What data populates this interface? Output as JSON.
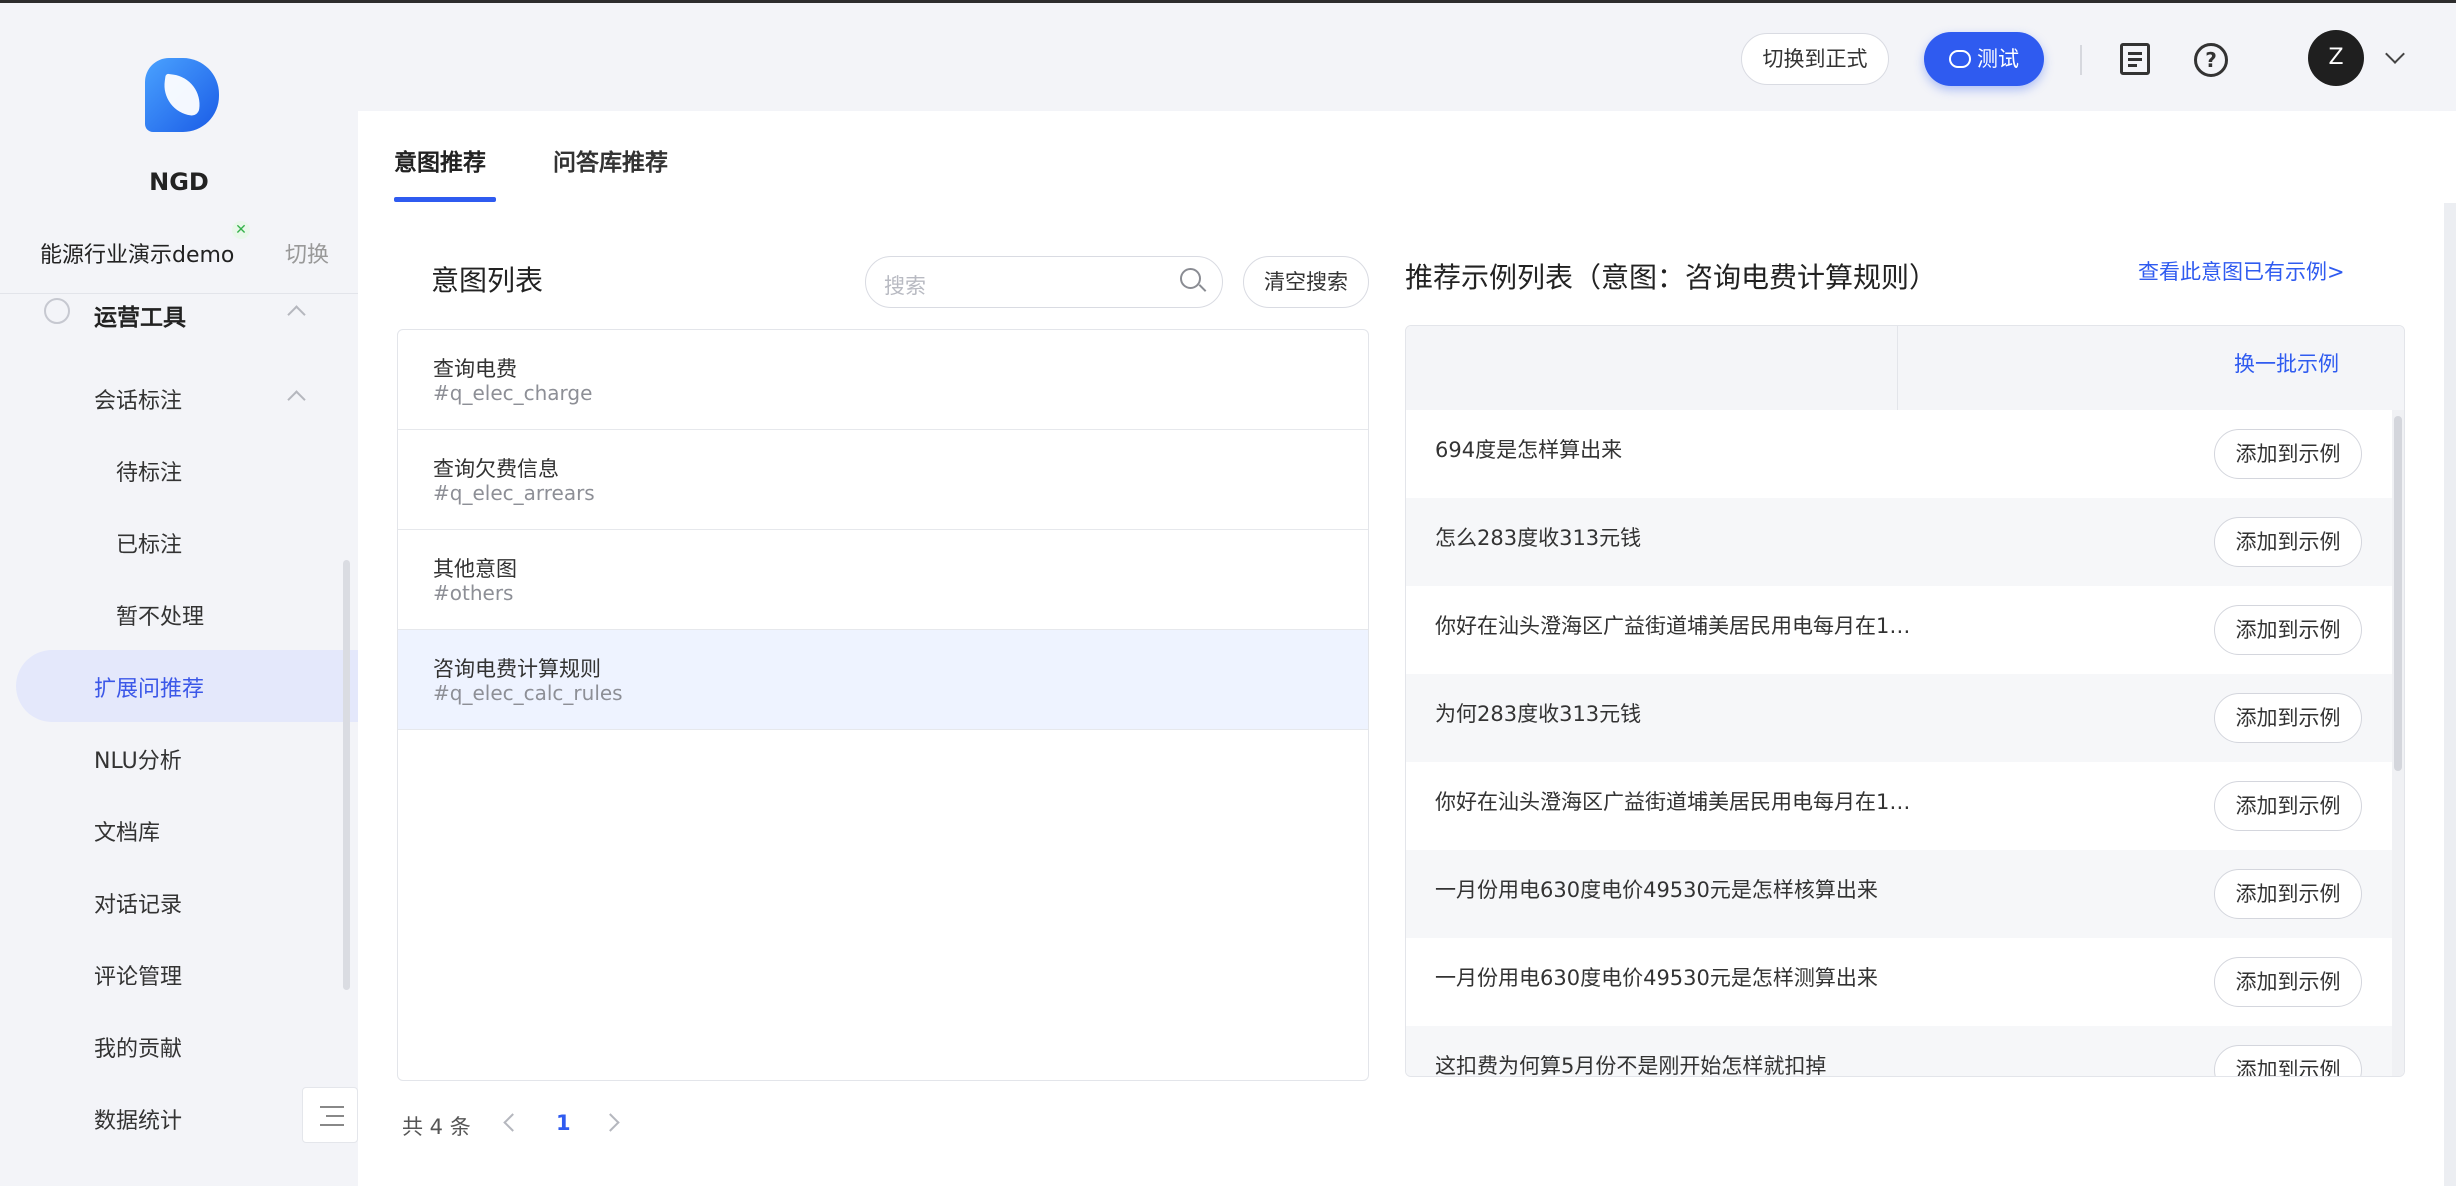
{
  "sidebar": {
    "brand": "NGD",
    "tenant": "能源行业演示demo",
    "tenant_switch": "切换",
    "group": "运营工具",
    "sub_group": "会话标注",
    "sub_items": [
      "待标注",
      "已标注",
      "暂不处理"
    ],
    "items": [
      "扩展问推荐",
      "NLU分析",
      "文档库",
      "对话记录",
      "评论管理",
      "我的贡献",
      "数据统计"
    ],
    "active_item": "扩展问推荐"
  },
  "topbar": {
    "switch_button": "切换到正式",
    "test_button": "测试",
    "avatar_initial": "Z"
  },
  "tabs": [
    "意图推荐",
    "问答库推荐"
  ],
  "intent_panel": {
    "title": "意图列表",
    "search_placeholder": "搜索",
    "clear_button": "清空搜索",
    "intents": [
      {
        "name": "查询电费",
        "id": "#q_elec_charge"
      },
      {
        "name": "查询欠费信息",
        "id": "#q_elec_arrears"
      },
      {
        "name": "其他意图",
        "id": "#others"
      },
      {
        "name": "咨询电费计算规则",
        "id": "#q_elec_calc_rules"
      }
    ],
    "total": "共 4 条",
    "current_page": "1"
  },
  "example_panel": {
    "title": "推荐示例列表（意图：咨询电费计算规则）",
    "view_link": "查看此意图已有示例>",
    "refresh_link": "换一批示例",
    "add_label": "添加到示例",
    "examples": [
      "694度是怎样算出来",
      "怎么283度收313元钱",
      "你好在汕头澄海区广益街道埔美居民用电每月在1…",
      "为何283度收313元钱",
      "你好在汕头澄海区广益街道埔美居民用电每月在1…",
      "一月份用电630度电价49530元是怎样核算出来",
      "一月份用电630度电价49530元是怎样测算出来",
      "这扣费为何算5月份不是刚开始怎样就扣掉"
    ]
  },
  "colors": {
    "accent": "#2f5bf0",
    "active_bg": "#e4e8fb",
    "selected_row": "#eef3ff"
  }
}
